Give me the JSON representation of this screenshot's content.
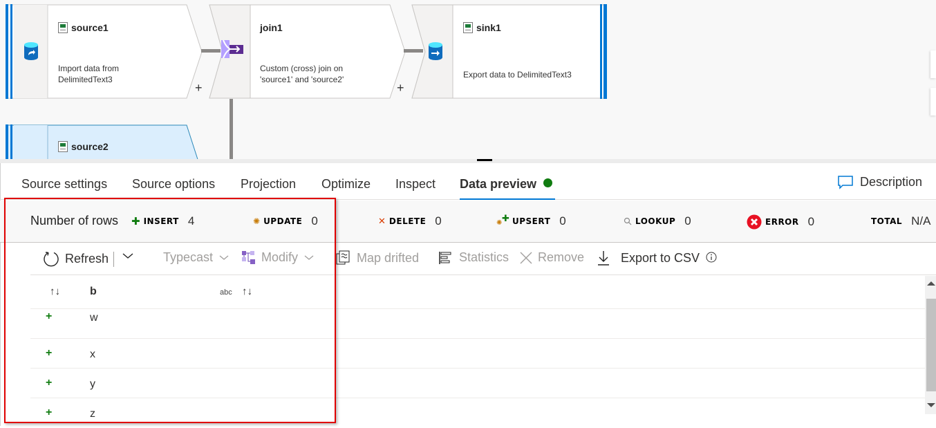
{
  "canvas": {
    "nodes": [
      {
        "id": "source1",
        "title": "source1",
        "description_lines": [
          "Import data from",
          "DelimitedText3"
        ],
        "kind": "source",
        "icon": "source-db-icon"
      },
      {
        "id": "join1",
        "title": "join1",
        "description_lines": [
          "Custom (cross) join on",
          "'source1' and 'source2'"
        ],
        "kind": "join",
        "icon": "join-icon"
      },
      {
        "id": "sink1",
        "title": "sink1",
        "description_lines": [
          "Export data to DelimitedText3"
        ],
        "kind": "sink",
        "icon": "sink-db-icon"
      },
      {
        "id": "source2",
        "title": "source2",
        "description_lines": [],
        "kind": "source",
        "icon": "source-db-icon",
        "selected": true
      }
    ],
    "add_symbol": "+"
  },
  "tabs": {
    "items": [
      {
        "label": "Source settings"
      },
      {
        "label": "Source options"
      },
      {
        "label": "Projection"
      },
      {
        "label": "Optimize"
      },
      {
        "label": "Inspect"
      },
      {
        "label": "Data preview",
        "active": true,
        "status": "success"
      }
    ],
    "description_label": "Description"
  },
  "stats": {
    "title": "Number of rows",
    "items": [
      {
        "label": "INSERT",
        "value": "4",
        "icon": "plus-icon"
      },
      {
        "label": "UPDATE",
        "value": "0",
        "icon": "asterisk-icon"
      },
      {
        "label": "DELETE",
        "value": "0",
        "icon": "x-icon"
      },
      {
        "label": "UPSERT",
        "value": "0",
        "icon": "upsert-icon"
      },
      {
        "label": "LOOKUP",
        "value": "0",
        "icon": "search-icon"
      },
      {
        "label": "ERROR",
        "value": "0",
        "icon": "error-icon"
      },
      {
        "label": "TOTAL",
        "value": "N/A"
      }
    ]
  },
  "toolbar": {
    "refresh": "Refresh",
    "typecast": "Typecast",
    "modify": "Modify",
    "map_drifted": "Map drifted",
    "statistics": "Statistics",
    "remove": "Remove",
    "export_csv": "Export to CSV"
  },
  "grid": {
    "columns": [
      {
        "name": "b",
        "type": "abc"
      }
    ],
    "sort_symbol": "↑↓",
    "rows": [
      {
        "op": "+",
        "b": "w"
      },
      {
        "op": "+",
        "b": "x"
      },
      {
        "op": "+",
        "b": "y"
      },
      {
        "op": "+",
        "b": "z"
      }
    ]
  },
  "colors": {
    "accent": "#0078d4",
    "success": "#107c10",
    "error": "#e81123",
    "highlight": "#e00000",
    "selected_node": "#dbeefd"
  }
}
